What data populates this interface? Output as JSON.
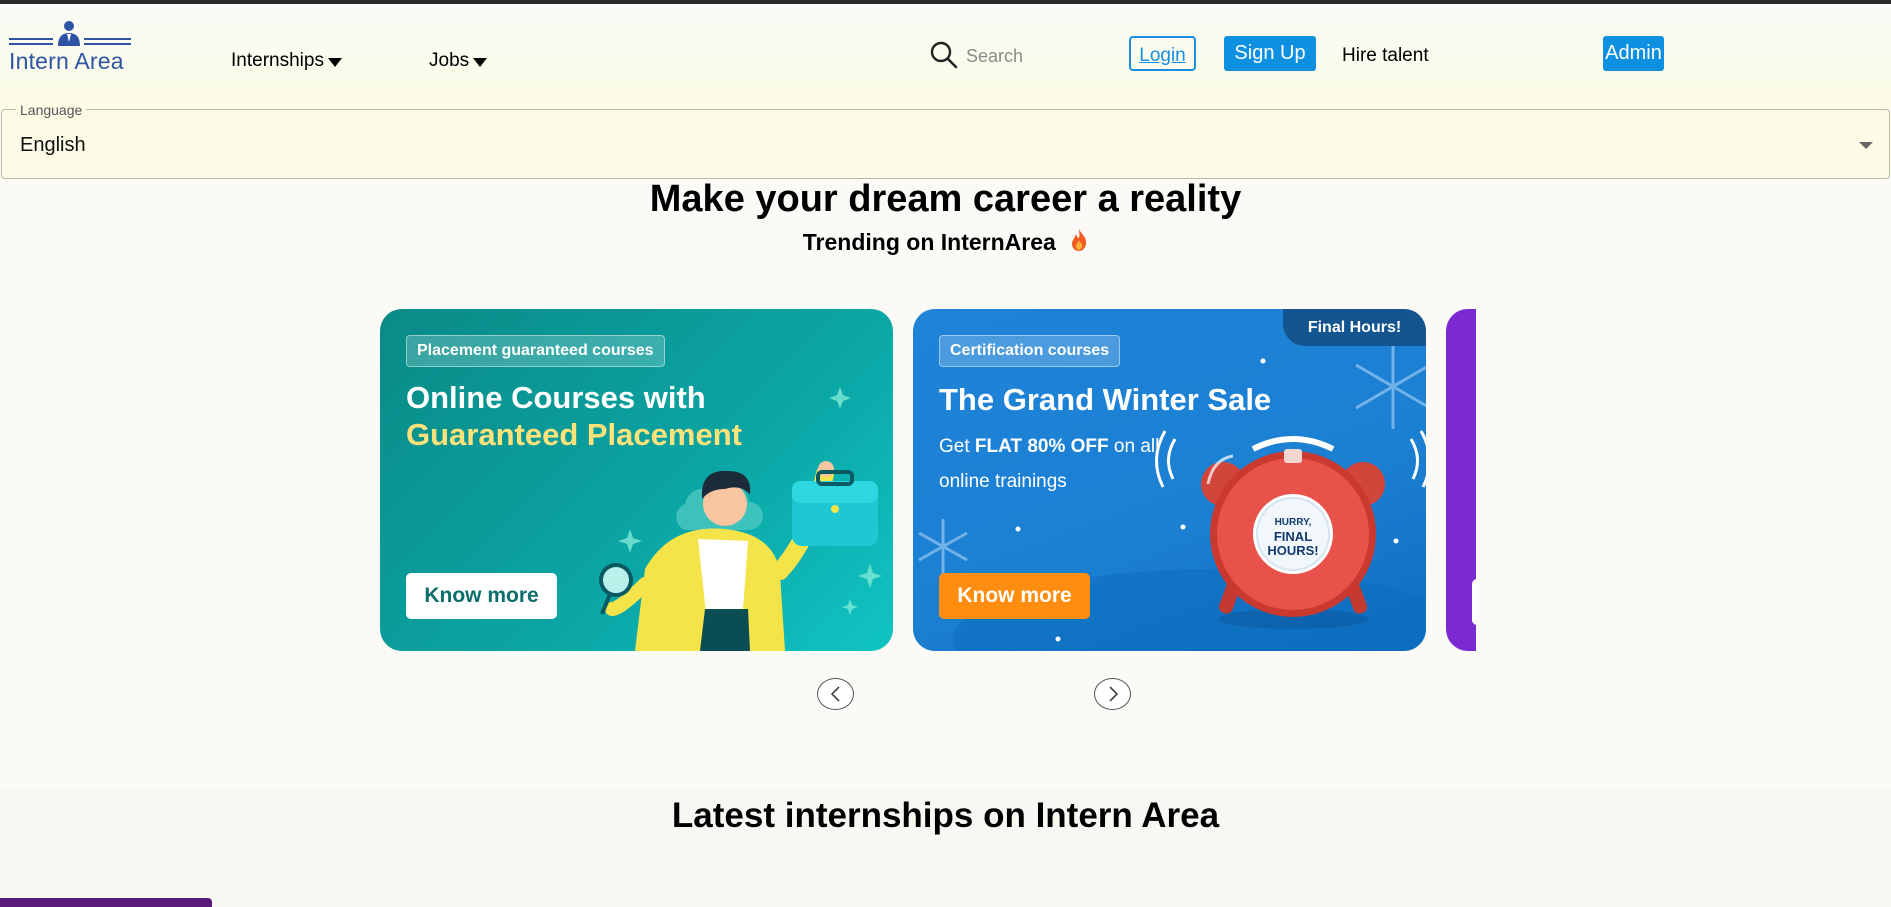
{
  "header": {
    "logo_text": "Intern Area",
    "nav": [
      {
        "label": "Internships"
      },
      {
        "label": "Jobs"
      }
    ],
    "search": {
      "placeholder": "Search"
    },
    "login_label": "Login",
    "signup_label": "Sign Up",
    "hire_label": "Hire talent",
    "admin_label": "Admin"
  },
  "language": {
    "legend": "Language",
    "selected": "English"
  },
  "hero": {
    "title": "Make your dream career a reality",
    "trending": "Trending on InternArea"
  },
  "carousel": {
    "cards": [
      {
        "badge": "Placement guaranteed courses",
        "title_line1": "Online Courses with",
        "title_line2": "Guaranteed Placement",
        "button": "Know more"
      },
      {
        "badge": "Certification courses",
        "tag": "Final Hours!",
        "title": "The Grand Winter Sale",
        "sub_prefix": "Get ",
        "sub_bold": "FLAT 80% OFF",
        "sub_suffix": " on all online trainings",
        "clock_line1": "HURRY,",
        "clock_line2": "FINAL",
        "clock_line3": "HOURS!",
        "button": "Know more"
      }
    ]
  },
  "latest": {
    "title": "Latest internships on Intern Area"
  },
  "colors": {
    "brand_blue": "#0e90e0",
    "logo_blue": "#2e54a4",
    "card1_teal": "#0ba6a6",
    "card2_blue": "#1b7fd2",
    "card3_purple": "#7a2ad0",
    "accent_orange": "#ff8d0f"
  }
}
